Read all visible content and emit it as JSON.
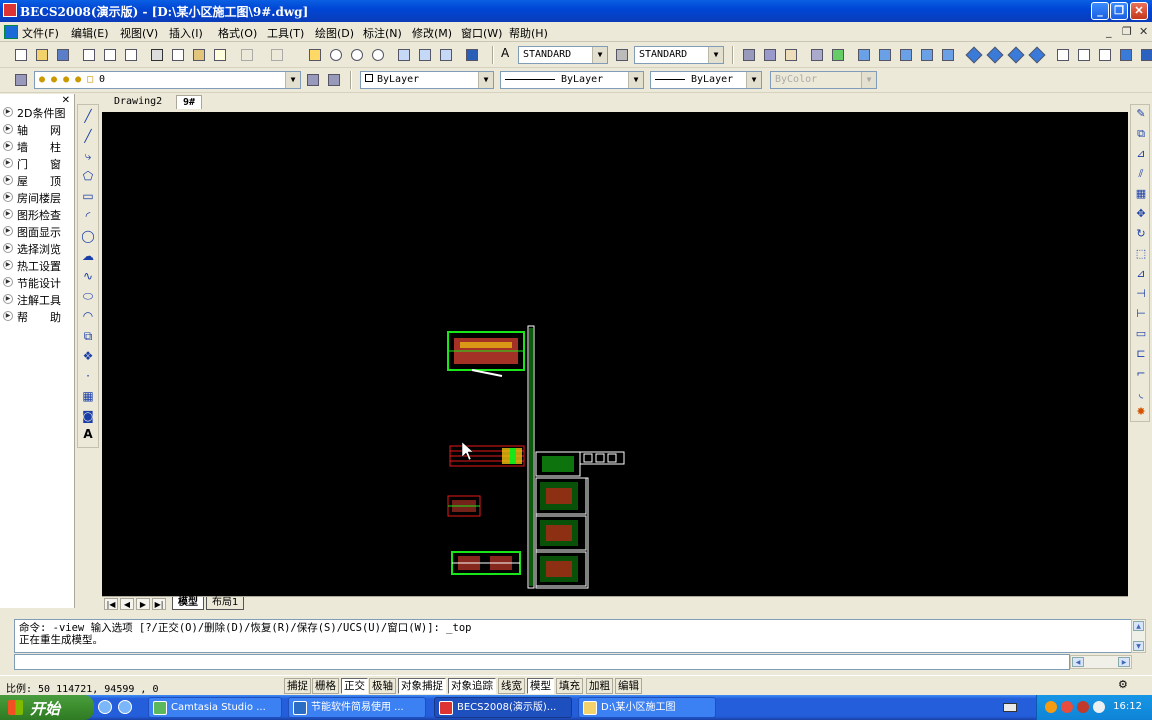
{
  "window": {
    "title": "BECS2008(演示版) - [D:\\某小区施工图\\9#.dwg]"
  },
  "menu": {
    "items": [
      "文件(F)",
      "编辑(E)",
      "视图(V)",
      "插入(I)",
      "格式(O)",
      "工具(T)",
      "绘图(D)",
      "标注(N)",
      "修改(M)",
      "窗口(W)",
      "帮助(H)"
    ]
  },
  "toolbar": {
    "text_style": "STANDARD",
    "dim_style": "STANDARD",
    "layer": "0",
    "color": "ByLayer",
    "linetype": "ByLayer",
    "lineweight": "ByLayer",
    "plotstyle": "ByColor"
  },
  "sidebar": {
    "items": [
      "2D条件图",
      "轴　　网",
      "墙　　柱",
      "门　　窗",
      "屋　　顶",
      "房间楼层",
      "图形检查",
      "图面显示",
      "选择浏览",
      "热工设置",
      "节能设计",
      "注解工具",
      "帮　　助"
    ]
  },
  "doc_tabs": [
    "Drawing2",
    "9#"
  ],
  "layout_tabs": [
    "模型",
    "布局1"
  ],
  "command": {
    "line1": "命令: -view 输入选项 [?/正交(O)/删除(D)/恢复(R)/保存(S)/UCS(U)/窗口(W)]: _top",
    "line2": "正在重生成模型。"
  },
  "status": {
    "scale_label": "比例: 50",
    "coords": "114721, 94599 , 0",
    "buttons": [
      "捕捉",
      "栅格",
      "正交",
      "极轴",
      "对象捕捉",
      "对象追踪",
      "线宽",
      "模型",
      "填充",
      "加粗",
      "编辑"
    ]
  },
  "taskbar": {
    "start": "开始",
    "tasks": [
      "Camtasia Studio ...",
      "节能软件简易使用 ...",
      "BECS2008(演示版)...",
      "D:\\某小区施工图"
    ],
    "clock": "16:12"
  },
  "colors": {
    "canvas_bg": "#000000",
    "xp_blue": "#245edb",
    "drawing_green": "#19e619",
    "drawing_red": "#e61919"
  }
}
